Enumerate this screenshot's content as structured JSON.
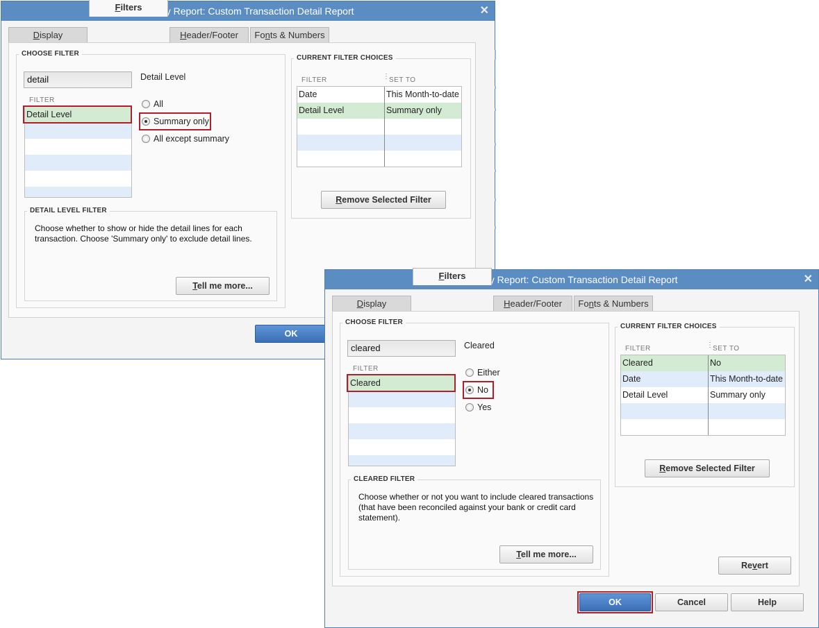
{
  "dialog1": {
    "title": "Modify Report: Custom Transaction Detail Report",
    "tabs": [
      {
        "label": "Display",
        "ul": "D",
        "rest": "isplay"
      },
      {
        "label": "Filters",
        "ul": "F",
        "rest": "ilters"
      },
      {
        "label": "Header/Footer",
        "ul": "H",
        "rest": "eader/Footer"
      },
      {
        "label": "Fonts & Numbers",
        "pre": "Fo",
        "ul": "n",
        "rest": "ts & Numbers"
      }
    ],
    "choose_filter_title": "CHOOSE FILTER",
    "search_value": "detail",
    "filter_name": "Detail Level",
    "filter_col": "FILTER",
    "list_items": [
      "Detail Level"
    ],
    "options": [
      "All",
      "Summary only",
      "All except summary"
    ],
    "selected_option": "Summary only",
    "detail_group_title": "DETAIL LEVEL FILTER",
    "description": "Choose whether to show or hide the detail lines for each transaction. Choose 'Summary only' to exclude detail lines.",
    "tell_me_more": "Tell me more...",
    "current_title": "CURRENT FILTER CHOICES",
    "current_headers": [
      "FILTER",
      "SET TO"
    ],
    "current_rows": [
      {
        "filter": "Date",
        "set_to": "This Month-to-date"
      },
      {
        "filter": "Detail Level",
        "set_to": "Summary only"
      }
    ],
    "remove_filter": "Remove Selected Filter",
    "ok": "OK"
  },
  "dialog2": {
    "title": "Modify Report: Custom Transaction Detail Report",
    "tabs": [
      {
        "label": "Display",
        "ul": "D",
        "rest": "isplay"
      },
      {
        "label": "Filters",
        "ul": "F",
        "rest": "ilters"
      },
      {
        "label": "Header/Footer",
        "ul": "H",
        "rest": "eader/Footer"
      },
      {
        "label": "Fonts & Numbers",
        "pre": "Fo",
        "ul": "n",
        "rest": "ts & Numbers"
      }
    ],
    "choose_filter_title": "CHOOSE FILTER",
    "search_value": "cleared",
    "filter_name": "Cleared",
    "filter_col": "FILTER",
    "list_items": [
      "Cleared"
    ],
    "options": [
      "Either",
      "No",
      "Yes"
    ],
    "selected_option": "No",
    "cleared_group_title": "CLEARED FILTER",
    "description": "Choose whether or not you want to include cleared transactions (that have been reconciled against your bank or credit card statement).",
    "tell_me_more": "Tell me more...",
    "current_title": "CURRENT FILTER CHOICES",
    "current_headers": [
      "FILTER",
      "SET TO"
    ],
    "current_rows": [
      {
        "filter": "Cleared",
        "set_to": "No"
      },
      {
        "filter": "Date",
        "set_to": "This Month-to-date"
      },
      {
        "filter": "Detail Level",
        "set_to": "Summary only"
      }
    ],
    "remove_filter": "Remove Selected Filter",
    "revert": "Revert",
    "ok": "OK",
    "cancel": "Cancel",
    "help": "Help"
  },
  "colors": {
    "title_bar": "#5b8dc2",
    "selected_row": "#d3ead3",
    "alt_row": "#e1ecfb",
    "highlight_border": "#b01e2c",
    "primary_button": "#3a6fb6"
  }
}
